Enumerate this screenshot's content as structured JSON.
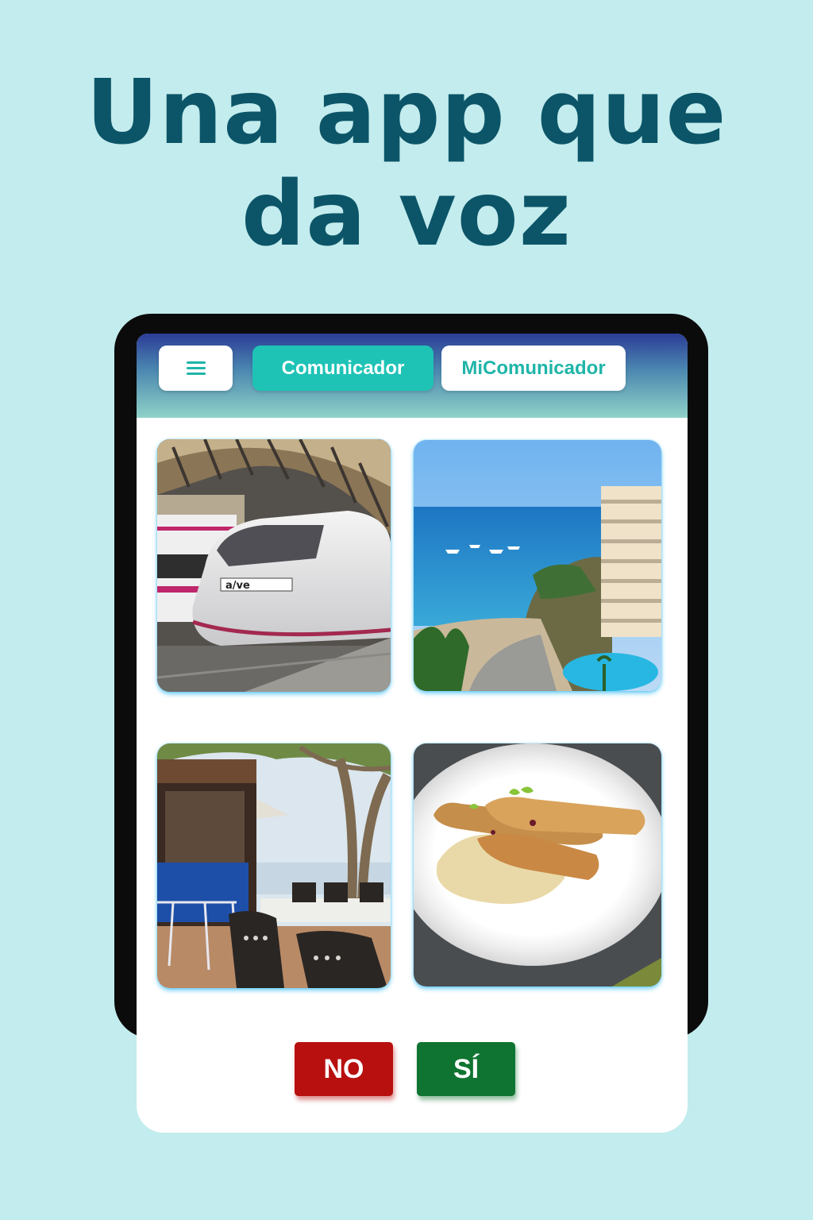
{
  "promo": {
    "headline_line1": "Una app que",
    "headline_line2": "da voz"
  },
  "app": {
    "menu_icon": "hamburger-menu-icon",
    "tabs": [
      {
        "label": "Comunicador",
        "active": true
      },
      {
        "label": "MiComunicador",
        "active": false
      }
    ],
    "tiles": [
      {
        "subject": "train"
      },
      {
        "subject": "beach-hotel"
      },
      {
        "subject": "terrace-cafe"
      },
      {
        "subject": "food-plate"
      }
    ],
    "answers": {
      "no_label": "NO",
      "yes_label": "SÍ"
    }
  },
  "colors": {
    "background": "#c3ecee",
    "headline": "#0c5568",
    "accent": "#1ec3b6",
    "no": "#b8100f",
    "yes": "#0f7431"
  }
}
